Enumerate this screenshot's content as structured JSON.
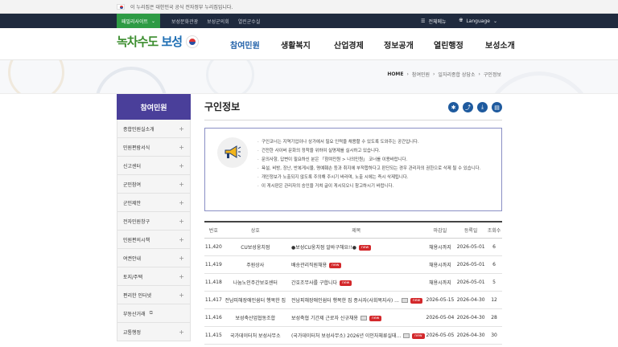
{
  "gov_bar": {
    "text": "이 누리집은 대한민국 공식 전자정부 누리집입니다."
  },
  "top_bar": {
    "family_site": "패밀리사이트",
    "links": [
      "보성문화관광",
      "보성군의회",
      "열린군수실"
    ],
    "full_menu": "전체메뉴",
    "language": "Language"
  },
  "logo": {
    "text_green": "녹차수도 ",
    "text_blue": "보성"
  },
  "gnb": [
    "참여민원",
    "생활복지",
    "산업경제",
    "정보공개",
    "열린행정",
    "보성소개"
  ],
  "breadcrumb": [
    "HOME",
    "참여민원",
    "일자리종합 상담소",
    "구인정보"
  ],
  "lnb": {
    "title": "참여민원",
    "items": [
      "종합민원실소개",
      "민원편람서식",
      "신고센터",
      "군민참여",
      "군민제안",
      "전자민원창구",
      "민원편의시책",
      "여권안내",
      "토지/주택",
      "편리한 인터넷",
      "부동산거래",
      "교통행정"
    ]
  },
  "page_title": "구인정보",
  "tools_icons": [
    "settings-icon",
    "share-icon",
    "download-icon",
    "print-icon"
  ],
  "notice": [
    "구인코너는 지역기업이나 상가에서 필요 인력을 채용할 수 있도록 도와주는 공간입니다.",
    "건전한 사이버 문화의 정착을 위하여 실명제를 실시하고 있습니다.",
    "문의사항, 답변이 필요하신 분은 「참여민원 > 나의민원」 코너를 이용바랍니다.",
    "욕설, 비방, 장난, 반복게시물, 명예훼손 등과 취지에 부적합하다고 판단되는 경우 관리자의 권한으로 삭제 될 수 있습니다.",
    "개인정보가 노출되지 않도록 주의해 주시기 바라며, 노출 시에는 즉시 삭제됩니다.",
    "이 게시판은 관리자의 승인을 거쳐 글이 게시되오니 참고하시기 바랍니다."
  ],
  "table": {
    "headers": [
      "번호",
      "상호",
      "제목",
      "마감일",
      "등록일",
      "조회수"
    ],
    "new_label": "new",
    "rows": [
      {
        "no": "11,420",
        "company": "CU보성웅치점",
        "title": "●보성CU웅치점 알바구해요!!●",
        "img": false,
        "deadline": "채용시까지",
        "date": "2026-05-01",
        "views": "6"
      },
      {
        "no": "11,419",
        "company": "주원상사",
        "title": "배송관리직원채용",
        "img": false,
        "deadline": "채용시까지",
        "date": "2026-05-01",
        "views": "6"
      },
      {
        "no": "11,418",
        "company": "나눔노인주간보호센터",
        "title": "간호조무사를 구합니다",
        "img": false,
        "deadline": "채용시까지",
        "date": "2026-05-01",
        "views": "5"
      },
      {
        "no": "11,417",
        "company": "전남피해장애인쉼터 행복한 집",
        "title": "전남피해장애인쉼터 행복한 집 종사자(사회복지사) ...",
        "img": true,
        "deadline": "2026-05-15",
        "date": "2026-04-30",
        "views": "12"
      },
      {
        "no": "11,416",
        "company": "보성축산업협동조합",
        "title": "보성축협 기간제 근로자 신규채용",
        "img": true,
        "deadline": "2026-05-04",
        "date": "2026-04-30",
        "views": "28"
      },
      {
        "no": "11,415",
        "company": "국가데이터처 보성사무소",
        "title": "(국가데이터처 보성사무소) 2026년 이인자체류실태...",
        "img": true,
        "deadline": "2026-05-05",
        "date": "2026-04-30",
        "views": "30"
      }
    ]
  }
}
